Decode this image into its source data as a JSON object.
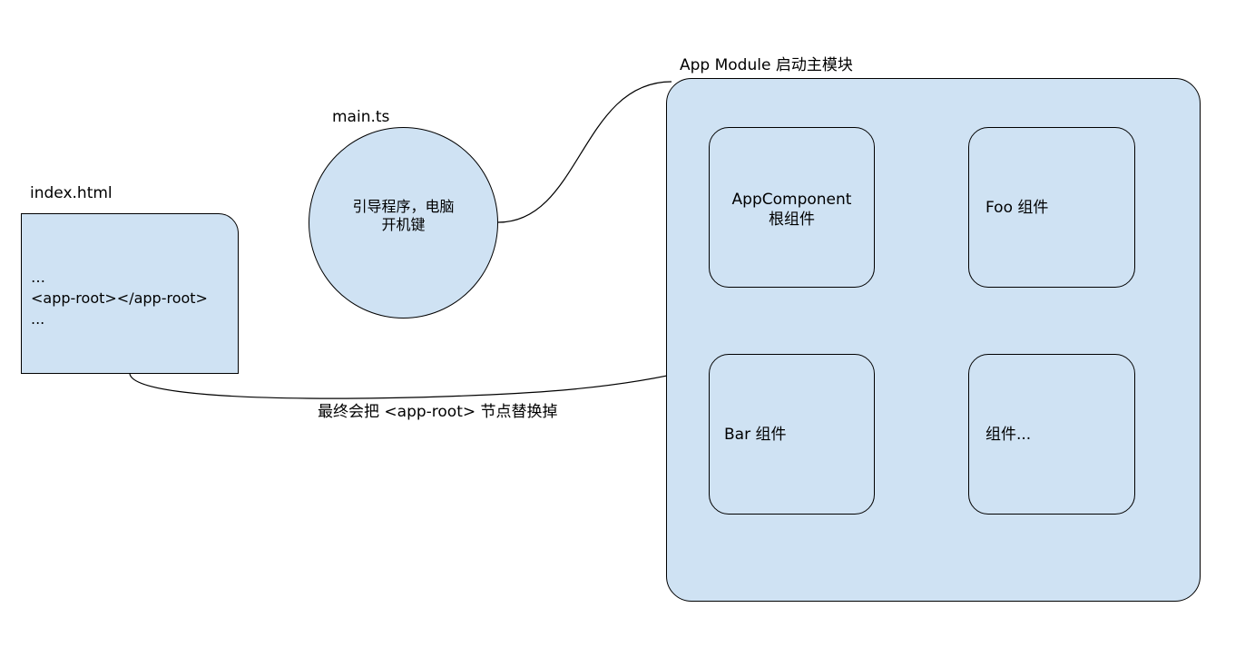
{
  "index_file": {
    "title": "index.html",
    "lines": [
      "…",
      "<app-root></app-root>",
      "..."
    ]
  },
  "main_file": {
    "title": "main.ts",
    "text_line1": "引导程序，电脑",
    "text_line2": "开机键"
  },
  "app_module": {
    "title": "App Module 启动主模块",
    "components": {
      "app_line1": "AppComponent",
      "app_line2": "根组件",
      "foo": "Foo 组件",
      "bar": "Bar 组件",
      "more": "组件..."
    }
  },
  "replace_note": "最终会把 <app-root> 节点替换掉",
  "colors": {
    "fill": "#cfe2f3",
    "stroke": "#000000"
  }
}
